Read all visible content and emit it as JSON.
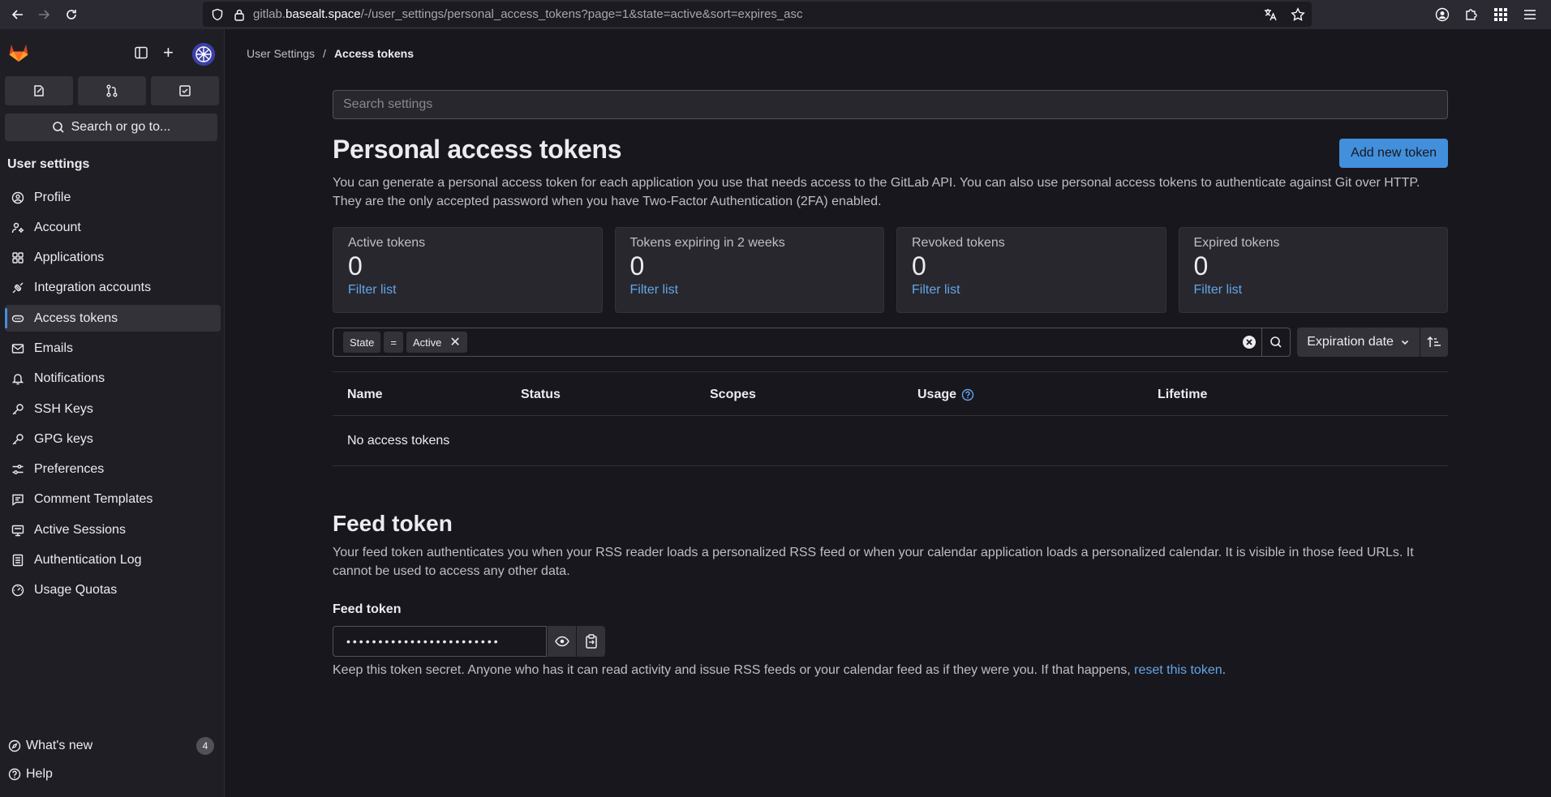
{
  "browser": {
    "url_prefix": "gitlab.",
    "url_host": "basealt.space",
    "url_path": "/-/user_settings/personal_access_tokens?page=1&state=active&sort=expires_asc"
  },
  "sidebar": {
    "search_label": "Search or go to...",
    "section_title": "User settings",
    "items": [
      {
        "label": "Profile",
        "icon": "profile-icon"
      },
      {
        "label": "Account",
        "icon": "account-icon"
      },
      {
        "label": "Applications",
        "icon": "applications-icon"
      },
      {
        "label": "Integration accounts",
        "icon": "plug-icon"
      },
      {
        "label": "Access tokens",
        "icon": "token-icon",
        "active": true
      },
      {
        "label": "Emails",
        "icon": "mail-icon"
      },
      {
        "label": "Notifications",
        "icon": "bell-icon"
      },
      {
        "label": "SSH Keys",
        "icon": "key-icon"
      },
      {
        "label": "GPG keys",
        "icon": "key-icon"
      },
      {
        "label": "Preferences",
        "icon": "preferences-icon"
      },
      {
        "label": "Comment Templates",
        "icon": "comment-icon"
      },
      {
        "label": "Active Sessions",
        "icon": "monitor-icon"
      },
      {
        "label": "Authentication Log",
        "icon": "log-icon"
      },
      {
        "label": "Usage Quotas",
        "icon": "quota-icon"
      }
    ],
    "whats_new": "What's new",
    "whats_new_count": "4",
    "help": "Help"
  },
  "breadcrumb": {
    "parent": "User Settings",
    "separator": "/",
    "current": "Access tokens"
  },
  "search_settings_placeholder": "Search settings",
  "page": {
    "title": "Personal access tokens",
    "add_button": "Add new token",
    "description": "You can generate a personal access token for each application you use that needs access to the GitLab API. You can also use personal access tokens to authenticate against Git over HTTP. They are the only accepted password when you have Two-Factor Authentication (2FA) enabled."
  },
  "stats": [
    {
      "label": "Active tokens",
      "value": "0",
      "link": "Filter list"
    },
    {
      "label": "Tokens expiring in 2 weeks",
      "value": "0",
      "link": "Filter list"
    },
    {
      "label": "Revoked tokens",
      "value": "0",
      "link": "Filter list"
    },
    {
      "label": "Expired tokens",
      "value": "0",
      "link": "Filter list"
    }
  ],
  "filter": {
    "token_key": "State",
    "token_op": "=",
    "token_value": "Active",
    "sort_label": "Expiration date"
  },
  "table": {
    "columns": [
      "Name",
      "Status",
      "Scopes",
      "Usage",
      "Lifetime"
    ],
    "empty": "No access tokens"
  },
  "feed": {
    "title": "Feed token",
    "description": "Your feed token authenticates you when your RSS reader loads a personalized RSS feed or when your calendar application loads a personalized calendar. It is visible in those feed URLs. It cannot be used to access any other data.",
    "label": "Feed token",
    "masked_value": "••••••••••••••••••••••••",
    "help_text": "Keep this token secret. Anyone who has it can read activity and issue RSS feeds or your calendar feed as if they were you. If that happens, ",
    "help_link": "reset this token",
    "help_end": "."
  },
  "colors": {
    "accent": "#428fdc",
    "link": "#63a6e9",
    "background": "#18171d",
    "sidebar": "#1f1e24"
  }
}
